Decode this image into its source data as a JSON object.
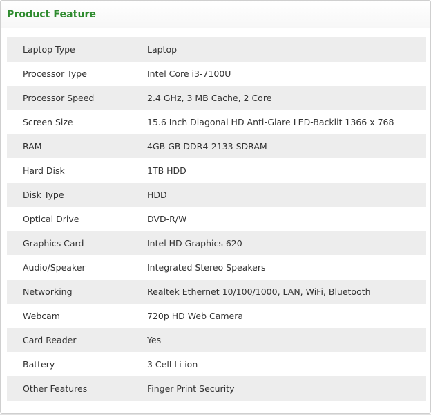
{
  "panel": {
    "title": "Product Feature"
  },
  "specs": [
    {
      "label": "Laptop Type",
      "value": "Laptop"
    },
    {
      "label": "Processor Type",
      "value": "Intel Core i3-7100U"
    },
    {
      "label": "Processor Speed",
      "value": "2.4 GHz, 3 MB Cache, 2 Core"
    },
    {
      "label": "Screen Size",
      "value": "15.6 Inch Diagonal HD Anti-Glare LED-Backlit 1366 x 768"
    },
    {
      "label": "RAM",
      "value": "4GB GB DDR4-2133 SDRAM"
    },
    {
      "label": "Hard Disk",
      "value": "1TB HDD"
    },
    {
      "label": "Disk Type",
      "value": "HDD"
    },
    {
      "label": "Optical Drive",
      "value": "DVD-R/W"
    },
    {
      "label": "Graphics Card",
      "value": "Intel HD Graphics 620"
    },
    {
      "label": "Audio/Speaker",
      "value": "Integrated Stereo Speakers"
    },
    {
      "label": "Networking",
      "value": "Realtek Ethernet 10/100/1000, LAN, WiFi, Bluetooth"
    },
    {
      "label": "Webcam",
      "value": "720p HD Web Camera"
    },
    {
      "label": "Card Reader",
      "value": "Yes"
    },
    {
      "label": "Battery",
      "value": "3 Cell Li-ion"
    },
    {
      "label": "Other Features",
      "value": "Finger Print Security"
    }
  ],
  "colors": {
    "title": "#2e8b2e",
    "row_shade": "#ededed",
    "text": "#333333"
  }
}
